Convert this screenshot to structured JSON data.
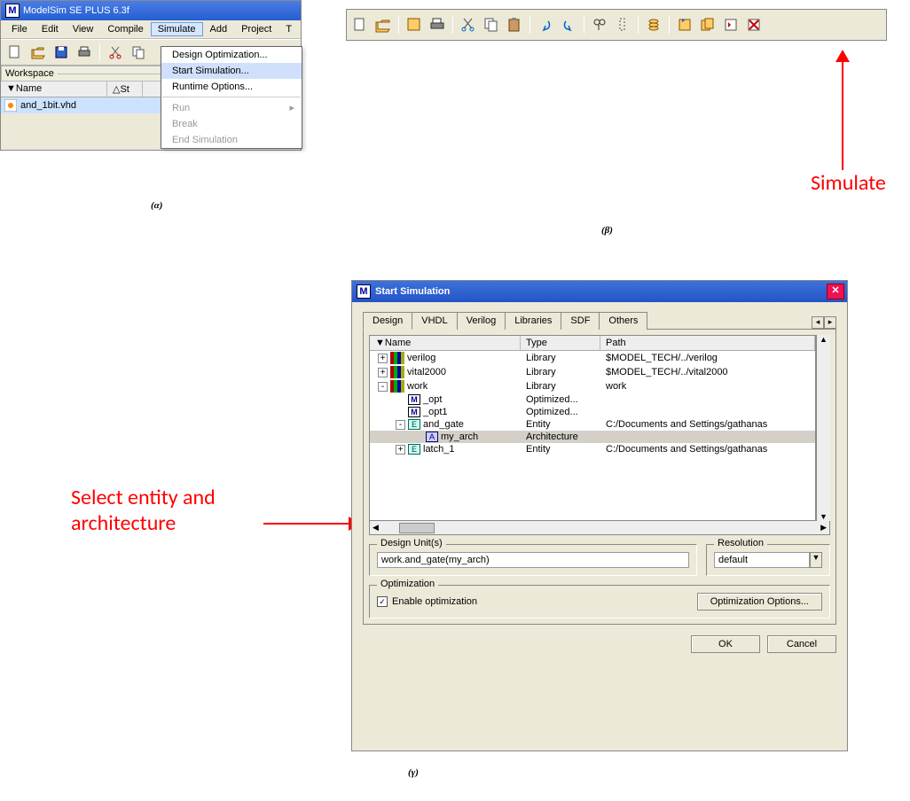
{
  "panelA": {
    "title": "ModelSim SE PLUS 6.3f",
    "menu": [
      "File",
      "Edit",
      "View",
      "Compile",
      "Simulate",
      "Add",
      "Project",
      "T"
    ],
    "activeMenu": "Simulate",
    "dropdown": {
      "items": [
        {
          "label": "Design Optimization...",
          "enabled": true
        },
        {
          "label": "Start Simulation...",
          "enabled": true,
          "highlight": true
        },
        {
          "label": "Runtime Options...",
          "enabled": true
        },
        {
          "sep": true
        },
        {
          "label": "Run",
          "enabled": false,
          "submenu": true
        },
        {
          "label": "Break",
          "enabled": false
        },
        {
          "label": "End Simulation",
          "enabled": false
        }
      ]
    },
    "workspace": {
      "label": "Workspace",
      "cols": [
        "Name",
        "St"
      ],
      "row": {
        "file": "and_1bit.vhd",
        "status": "✓"
      }
    }
  },
  "captions": {
    "a": "(α)",
    "b": "(β)",
    "g": "(γ)"
  },
  "annotationArrowRight": "Simulate",
  "annotationSelect": "Select entity and\narchitecture",
  "dialog": {
    "title": "Start Simulation",
    "tabs": [
      "Design",
      "VHDL",
      "Verilog",
      "Libraries",
      "SDF",
      "Others"
    ],
    "activeTab": "Design",
    "tree": {
      "cols": [
        "Name",
        "Type",
        "Path"
      ],
      "rows": [
        {
          "indent": 0,
          "exp": "+",
          "icon": "books",
          "name": "verilog",
          "type": "Library",
          "path": "$MODEL_TECH/../verilog"
        },
        {
          "indent": 0,
          "exp": "+",
          "icon": "books",
          "name": "vital2000",
          "type": "Library",
          "path": "$MODEL_TECH/../vital2000"
        },
        {
          "indent": 0,
          "exp": "-",
          "icon": "books",
          "name": "work",
          "type": "Library",
          "path": "work"
        },
        {
          "indent": 1,
          "exp": "",
          "icon": "M",
          "name": "_opt",
          "type": "Optimized...",
          "path": ""
        },
        {
          "indent": 1,
          "exp": "",
          "icon": "M",
          "name": "_opt1",
          "type": "Optimized...",
          "path": ""
        },
        {
          "indent": 1,
          "exp": "-",
          "icon": "E",
          "name": "and_gate",
          "type": "Entity",
          "path": "C:/Documents and Settings/gathanas"
        },
        {
          "indent": 2,
          "exp": "",
          "icon": "A",
          "name": "my_arch",
          "type": "Architecture",
          "path": "",
          "selected": true
        },
        {
          "indent": 1,
          "exp": "+",
          "icon": "E",
          "name": "latch_1",
          "type": "Entity",
          "path": "C:/Documents and Settings/gathanas"
        }
      ]
    },
    "designUnits": {
      "label": "Design Unit(s)",
      "value": "work.and_gate(my_arch)"
    },
    "resolution": {
      "label": "Resolution",
      "value": "default"
    },
    "optimization": {
      "label": "Optimization",
      "enable": "Enable optimization",
      "button": "Optimization Options..."
    },
    "ok": "OK",
    "cancel": "Cancel"
  }
}
